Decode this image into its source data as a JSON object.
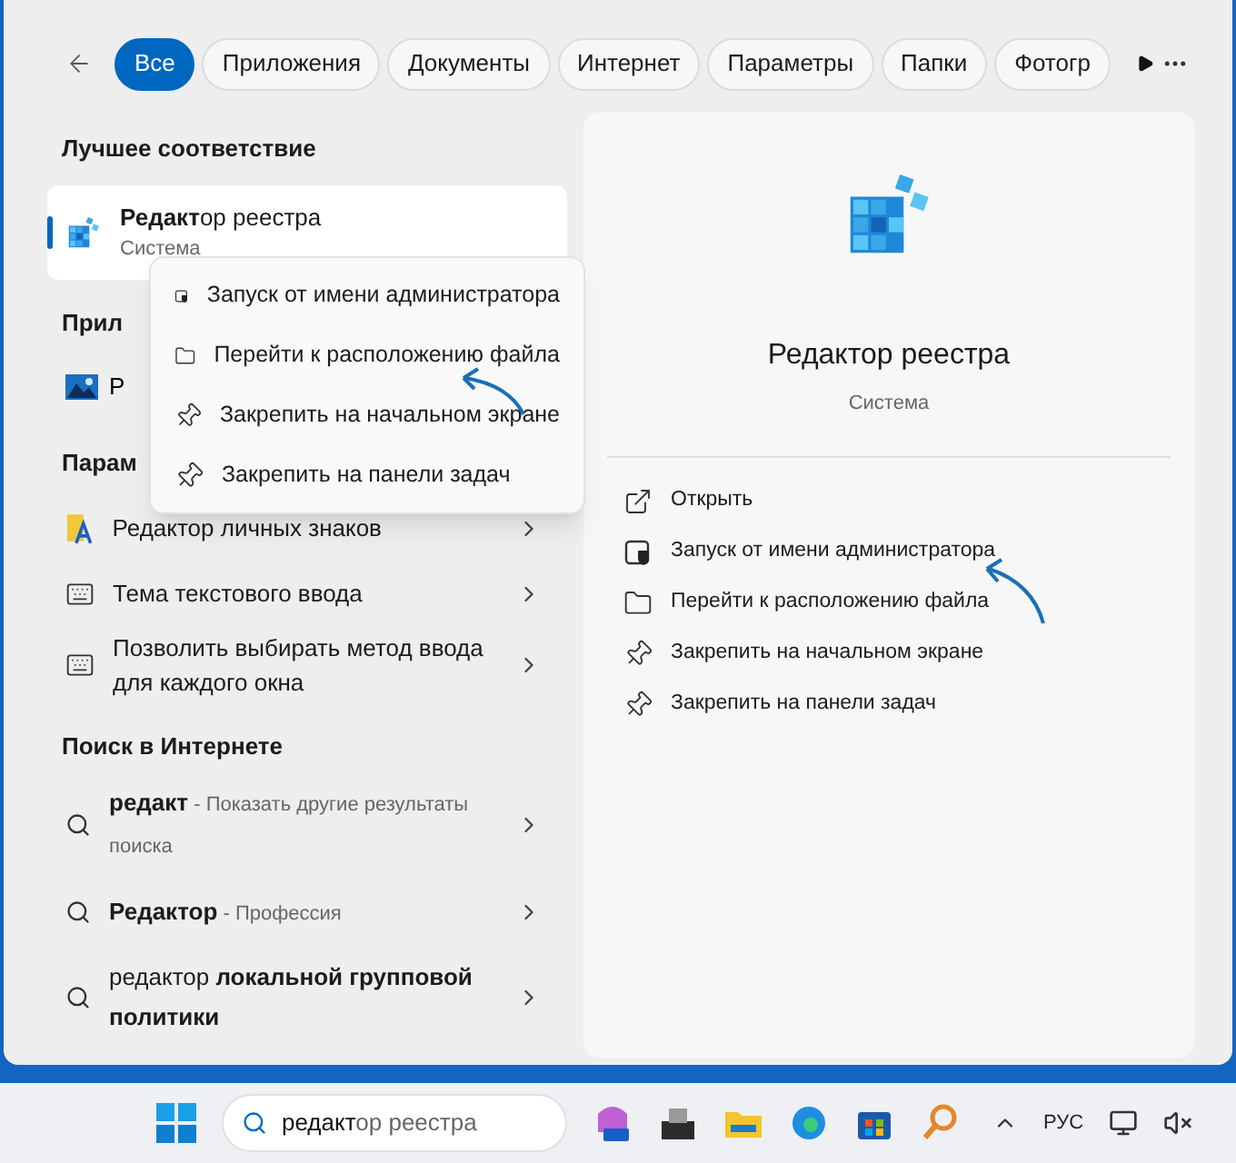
{
  "tabs": [
    {
      "label": "Все",
      "selected": true
    },
    {
      "label": "Приложения",
      "selected": false
    },
    {
      "label": "Документы",
      "selected": false
    },
    {
      "label": "Интернет",
      "selected": false
    },
    {
      "label": "Параметры",
      "selected": false
    },
    {
      "label": "Папки",
      "selected": false
    },
    {
      "label": "Фотогр",
      "selected": false
    }
  ],
  "results": [
    {
      "kind": "heading",
      "text": "Лучшее соответствие"
    },
    {
      "kind": "best",
      "title": "**Редакт**ор реестра",
      "subtitle": "Система",
      "selected": true
    },
    {
      "kind": "heading",
      "text": "Прил"
    },
    {
      "kind": "app",
      "title": "Р"
    },
    {
      "kind": "heading",
      "text": "Парам"
    },
    {
      "kind": "font-tool",
      "title": "Редактор личных знаков"
    },
    {
      "kind": "setting",
      "title": "Тема текстового ввода"
    },
    {
      "kind": "setting",
      "title": "Позволить выбирать метод ввода для каждого окна"
    },
    {
      "kind": "heading",
      "text": "Поиск в Интернете"
    },
    {
      "kind": "web",
      "query": "**редакт**",
      "hint": "- Показать другие результаты поиска"
    },
    {
      "kind": "web",
      "query": "**Редактор**",
      "hint": "- Профессия"
    },
    {
      "kind": "web",
      "query": "редактор **локальной групповой политики**"
    }
  ],
  "context_menu": [
    {
      "kind": "admin",
      "label": "Запуск от имени администратора"
    },
    {
      "kind": "folder",
      "label": "Перейти к расположению файла"
    },
    {
      "kind": "pin",
      "label": "Закрепить на начальном экране"
    },
    {
      "kind": "pin",
      "label": "Закрепить на панели задач"
    }
  ],
  "details": {
    "title": "Редактор реестра",
    "subtitle": "Система",
    "actions": [
      {
        "kind": "open",
        "label": "Открыть"
      },
      {
        "kind": "admin",
        "label": "Запуск от имени администратора"
      },
      {
        "kind": "folder",
        "label": "Перейти к расположению файла"
      },
      {
        "kind": "pin",
        "label": "Закрепить на начальном экране"
      },
      {
        "kind": "pin",
        "label": "Закрепить на панели задач"
      }
    ]
  },
  "taskbar": {
    "search_typed": "редакт",
    "search_suggestion": "ор реестра",
    "language": "РУС"
  }
}
